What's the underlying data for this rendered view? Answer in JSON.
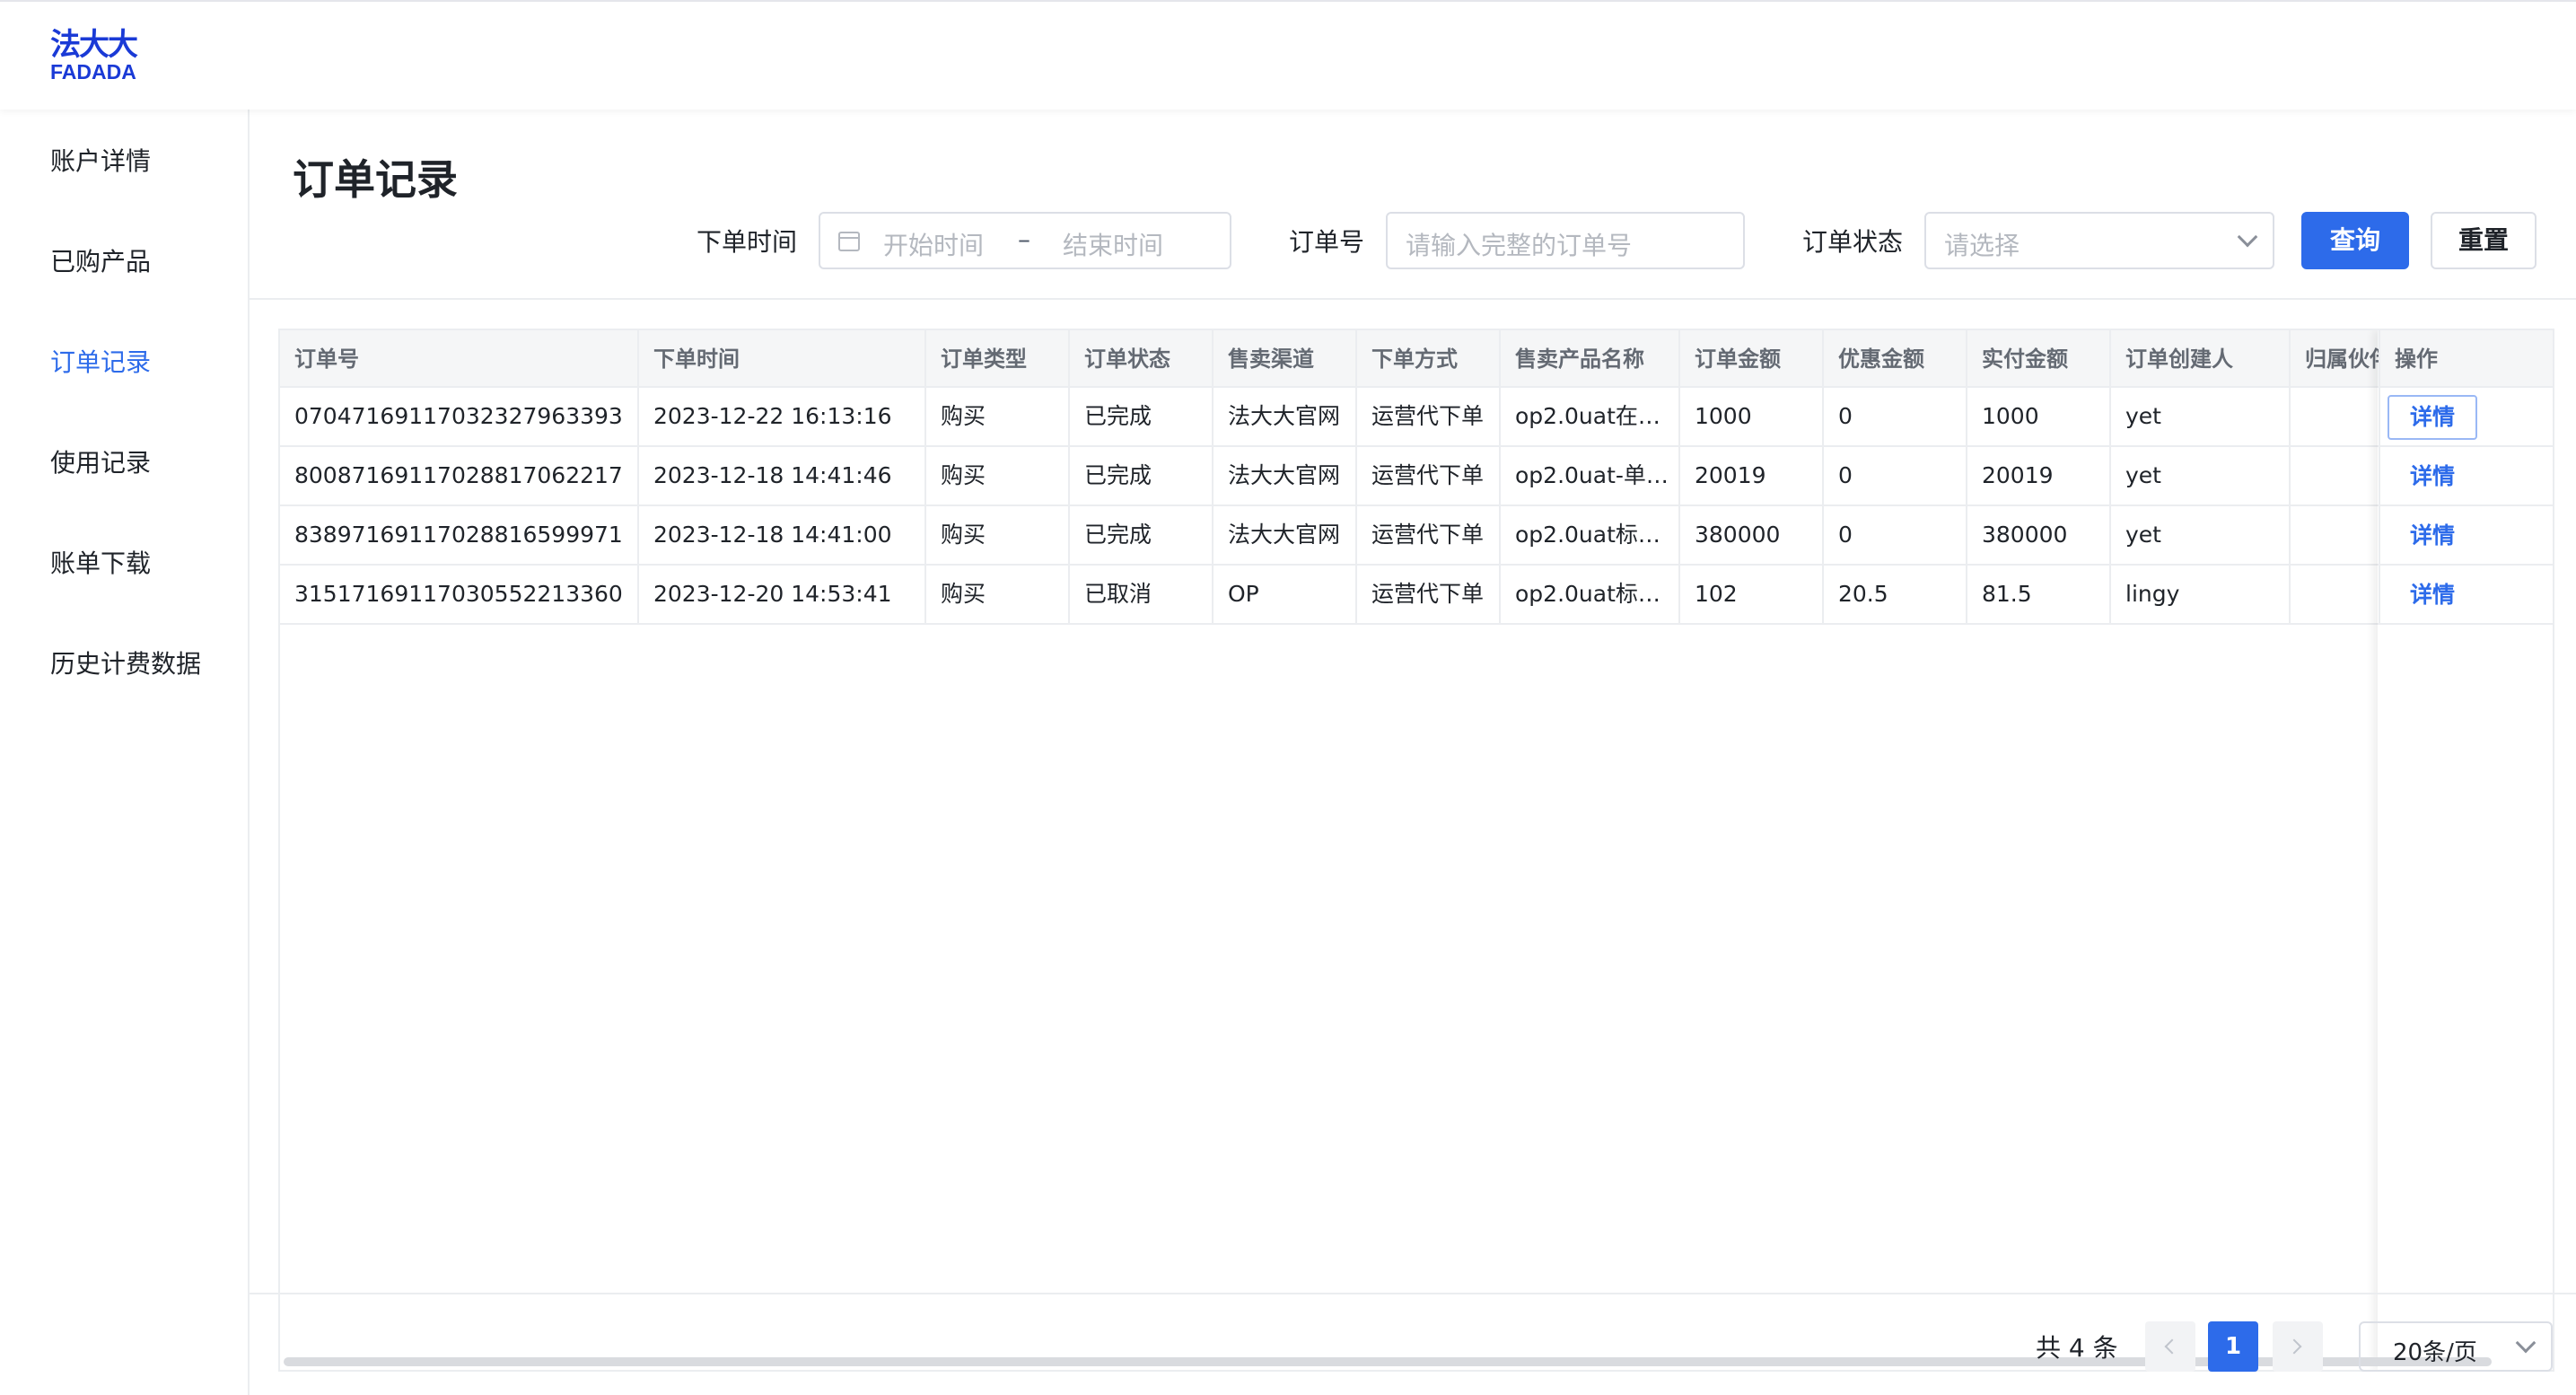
{
  "brand": {
    "logo_cn": "法大大",
    "logo_en": "FADADA"
  },
  "sidebar": {
    "items": [
      {
        "label": "账户详情",
        "active": false
      },
      {
        "label": "已购产品",
        "active": false
      },
      {
        "label": "订单记录",
        "active": true
      },
      {
        "label": "使用记录",
        "active": false
      },
      {
        "label": "账单下载",
        "active": false
      },
      {
        "label": "历史计费数据",
        "active": false
      }
    ]
  },
  "page": {
    "title": "订单记录"
  },
  "filters": {
    "order_time_label": "下单时间",
    "start_placeholder": "开始时间",
    "range_separator": "–",
    "end_placeholder": "结束时间",
    "order_no_label": "订单号",
    "order_no_placeholder": "请输入完整的订单号",
    "status_label": "订单状态",
    "status_placeholder": "请选择",
    "query_label": "查询",
    "reset_label": "重置"
  },
  "table": {
    "columns": [
      "订单号",
      "下单时间",
      "订单类型",
      "订单状态",
      "售卖渠道",
      "下单方式",
      "售卖产品名称",
      "订单金额",
      "优惠金额",
      "实付金额",
      "订单创建人",
      "归属伙伴",
      "操作"
    ],
    "rows": [
      {
        "order_no": "07047169117032327963393",
        "time": "2023-12-22 16:13:16",
        "type": "购买",
        "status": "已完成",
        "channel": "法大大官网",
        "method": "运营代下单",
        "product": "op2.0uat在…",
        "amount": "1000",
        "discount": "0",
        "paid": "1000",
        "creator": "yet",
        "partner": "",
        "action": "详情"
      },
      {
        "order_no": "80087169117028817062217",
        "time": "2023-12-18 14:41:46",
        "type": "购买",
        "status": "已完成",
        "channel": "法大大官网",
        "method": "运营代下单",
        "product": "op2.0uat-单…",
        "amount": "20019",
        "discount": "0",
        "paid": "20019",
        "creator": "yet",
        "partner": "",
        "action": "详情"
      },
      {
        "order_no": "83897169117028816599971",
        "time": "2023-12-18 14:41:00",
        "type": "购买",
        "status": "已完成",
        "channel": "法大大官网",
        "method": "运营代下单",
        "product": "op2.0uat标…",
        "amount": "380000",
        "discount": "0",
        "paid": "380000",
        "creator": "yet",
        "partner": "",
        "action": "详情"
      },
      {
        "order_no": "31517169117030552213360",
        "time": "2023-12-20 14:53:41",
        "type": "购买",
        "status": "已取消",
        "channel": "OP",
        "method": "运营代下单",
        "product": "op2.0uat标…",
        "amount": "102",
        "discount": "20.5",
        "paid": "81.5",
        "creator": "lingy",
        "partner": "",
        "action": "详情"
      }
    ]
  },
  "pagination": {
    "total_text": "共 4 条",
    "current_page": "1",
    "page_size": "20条/页"
  },
  "colors": {
    "accent": "#2d6bea",
    "brand": "#1a3ad6"
  },
  "icons": {
    "date": "calendar-icon",
    "select": "chevron-down-icon",
    "prev": "chevron-left-icon",
    "next": "chevron-right-icon"
  }
}
